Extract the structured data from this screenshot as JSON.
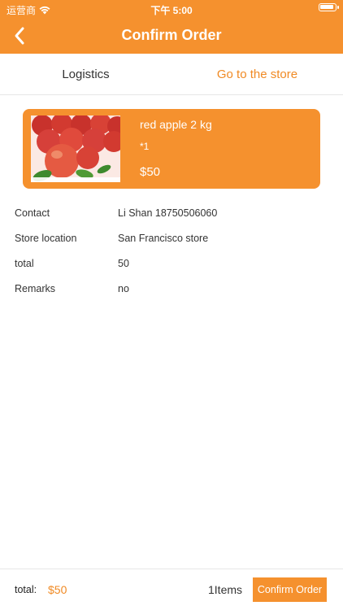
{
  "status_bar": {
    "carrier": "运营商",
    "time": "下午 5:00",
    "wifi_icon": "wifi-icon",
    "battery_icon": "battery-icon",
    "battery_level": 1.0
  },
  "nav": {
    "back_icon": "chevron-left-icon",
    "title": "Confirm Order"
  },
  "tabs": [
    {
      "label": "Logistics",
      "active": false
    },
    {
      "label": "Go to the store",
      "active": true
    }
  ],
  "product": {
    "image": "red-apples-image",
    "name": "red apple 2 kg",
    "quantity": "*1",
    "price": "$50"
  },
  "info": [
    {
      "label": "Contact",
      "value": "Li Shan  18750506060"
    },
    {
      "label": "Store location",
      "value": "San Francisco store"
    },
    {
      "label": "total",
      "value": "50"
    },
    {
      "label": "Remarks",
      "value": "no"
    }
  ],
  "bottom": {
    "total_label": "total:",
    "total_value": "$50",
    "items_count": "1Items",
    "confirm_label": "Confirm Order"
  },
  "colors": {
    "accent": "#f5912e",
    "accent_text": "#f08a24"
  }
}
